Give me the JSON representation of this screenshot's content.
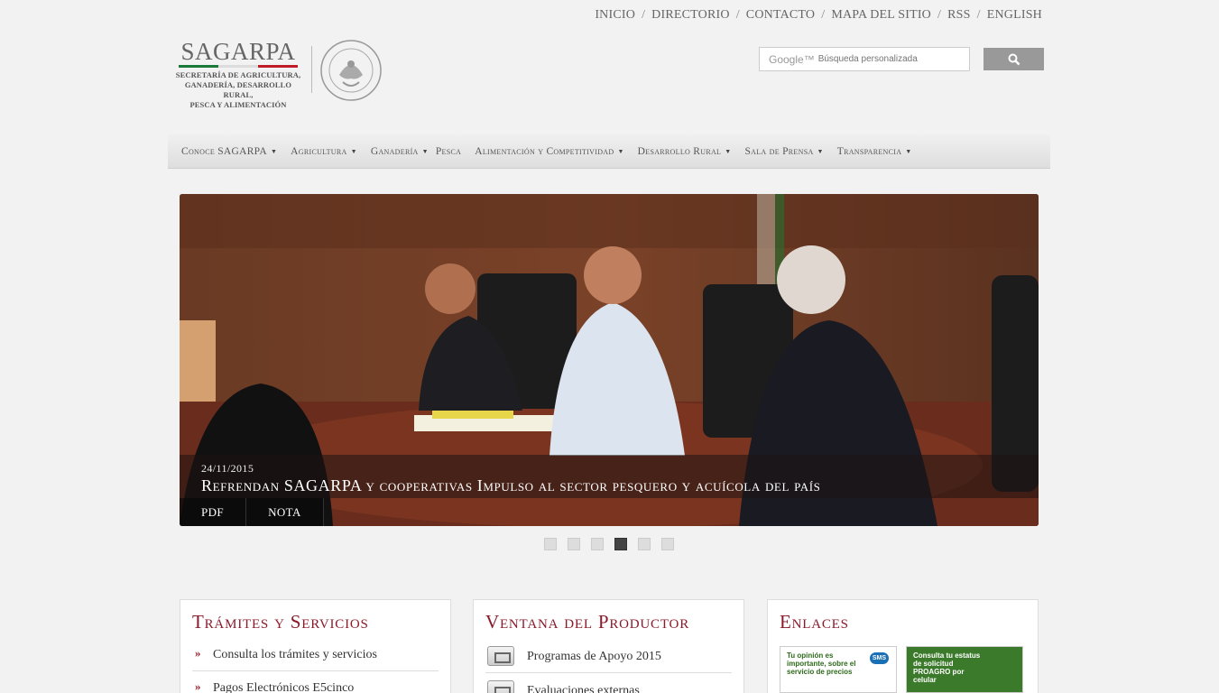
{
  "top_links": [
    "INICIO",
    "DIRECTORIO",
    "CONTACTO",
    "MAPA DEL SITIO",
    "RSS",
    "ENGLISH"
  ],
  "logo": {
    "name": "SAGARPA",
    "subtitle": [
      "SECRETARÍA DE AGRICULTURA,",
      "GANADERÍA, DESARROLLO RURAL,",
      "PESCA Y ALIMENTACIÓN"
    ],
    "bar_colors": [
      "#1a7a3a",
      "#ffffff",
      "#c01c28"
    ]
  },
  "search": {
    "google_label": "Google™",
    "placeholder": "Búsqueda personalizada",
    "button_icon": "search-icon"
  },
  "nav": [
    {
      "label": "Conoce SAGARPA",
      "dropdown": true
    },
    {
      "label": "Agricultura",
      "dropdown": true
    },
    {
      "label": "Ganadería",
      "dropdown": true
    },
    {
      "label": "Pesca",
      "dropdown": false
    },
    {
      "label": "Alimentación y Competitividad",
      "dropdown": true
    },
    {
      "label": "Desarrollo Rural",
      "dropdown": true
    },
    {
      "label": "Sala de Prensa",
      "dropdown": true
    },
    {
      "label": "Transparencia",
      "dropdown": true
    }
  ],
  "slider": {
    "date": "24/11/2015",
    "title": "Refrendan SAGARPA y cooperativas Impulso al sector pesquero y acuícola del país",
    "buttons": [
      "PDF",
      "NOTA"
    ],
    "dot_count": 6,
    "active_dot": 4
  },
  "panels": {
    "tramites": {
      "title": "Trámites y Servicios",
      "items": [
        "Consulta los trámites y servicios",
        "Pagos Electrónicos E5cinco"
      ]
    },
    "ventana": {
      "title": "Ventana del Productor",
      "items": [
        "Programas de Apoyo 2015",
        "Evaluaciones externas"
      ]
    },
    "enlaces": {
      "title": "Enlaces",
      "banners": [
        {
          "text": "Tu opinión es importante, sobre el servicio de precios",
          "badge": "SMS"
        },
        {
          "text": "Consulta tu estatus de solicitud PROAGRO por celular"
        }
      ]
    }
  }
}
